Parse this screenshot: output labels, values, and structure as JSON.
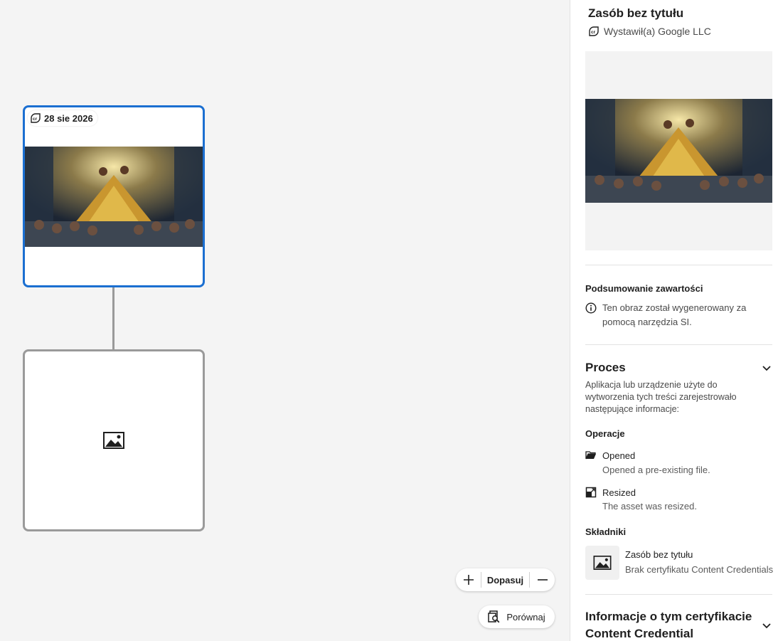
{
  "canvas": {
    "main_node": {
      "date": "28 sie 2026"
    },
    "zoom": {
      "fit_label": "Dopasuj"
    },
    "compare_label": "Porównaj"
  },
  "panel": {
    "title": "Zasób bez tytułu",
    "issuer": "Wystawił(a) Google LLC",
    "summary": {
      "heading": "Podsumowanie zawartości",
      "text_line1": "Ten obraz został wygenerowany za",
      "text_line2": "pomocą narzędzia SI."
    },
    "process": {
      "heading": "Proces",
      "desc_line1": "Aplikacja lub urządzenie użyte do",
      "desc_line2": "wytworzenia tych treści zarejestrowało",
      "desc_line3": "następujące informacje:",
      "operations_heading": "Operacje",
      "operations": [
        {
          "title": "Opened",
          "desc": "Opened a pre-existing file.",
          "icon": "folder-open-icon"
        },
        {
          "title": "Resized",
          "desc": "The asset was resized.",
          "icon": "resize-icon"
        }
      ],
      "ingredients_heading": "Składniki",
      "ingredient": {
        "title": "Zasób bez tytułu",
        "subtitle": "Brak certyfikatu Content Credentials"
      }
    },
    "credential_info": {
      "heading_line1": "Informacje o tym certyfikacie",
      "heading_line2": "Content Credential"
    }
  },
  "colors": {
    "accent": "#1b6fd1",
    "node_border": "#9a9a9a",
    "canvas_bg": "#f4f4f4"
  }
}
